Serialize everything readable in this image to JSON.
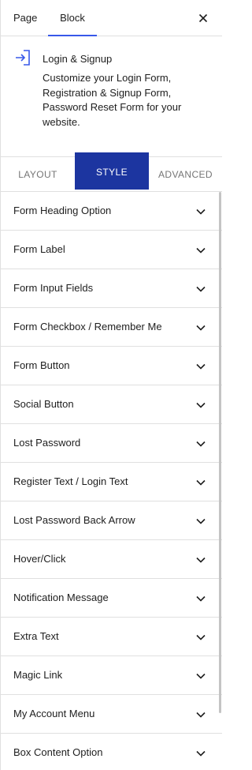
{
  "top_tabs": {
    "page_label": "Page",
    "block_label": "Block",
    "close_icon": "close-icon"
  },
  "block_card": {
    "icon": "login-arrow-icon",
    "title": "Login & Signup",
    "description": "Customize your Login Form, Registration & Signup Form, Password Reset Form for your website."
  },
  "section_tabs": {
    "layout": "LAYOUT",
    "style": "STYLE",
    "advanced": "ADVANCED",
    "active": "STYLE"
  },
  "accordion": {
    "items": [
      {
        "label": "Form Heading Option"
      },
      {
        "label": "Form Label"
      },
      {
        "label": "Form Input Fields"
      },
      {
        "label": "Form Checkbox / Remember Me"
      },
      {
        "label": "Form Button"
      },
      {
        "label": "Social Button"
      },
      {
        "label": "Lost Password"
      },
      {
        "label": "Register Text / Login Text"
      },
      {
        "label": "Lost Password Back Arrow"
      },
      {
        "label": "Hover/Click"
      },
      {
        "label": "Notification Message"
      },
      {
        "label": "Extra Text"
      },
      {
        "label": "Magic Link"
      },
      {
        "label": "My Account Menu"
      },
      {
        "label": "Box Content Option"
      }
    ],
    "chevron_icon": "chevron-down-icon"
  },
  "colors": {
    "accent": "#3858e9",
    "active_tab_bg": "#1c35a0",
    "border": "#e0e0e0"
  }
}
